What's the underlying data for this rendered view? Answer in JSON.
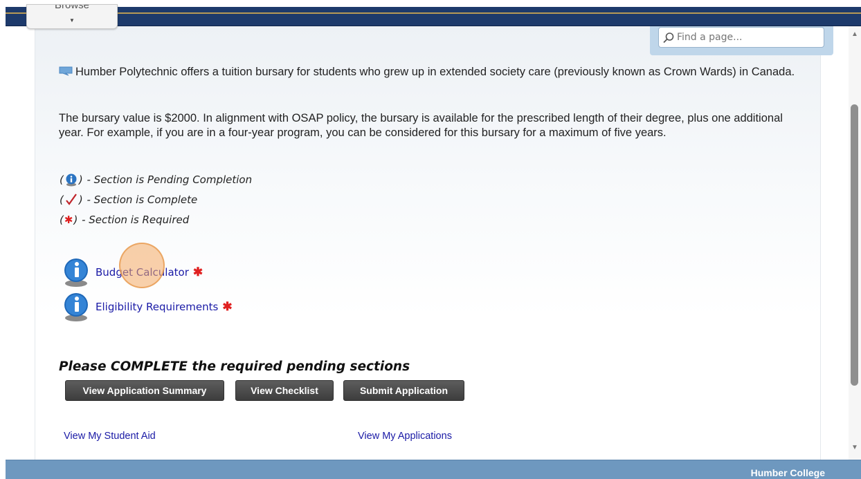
{
  "header": {
    "browse_label": "Browse"
  },
  "search": {
    "placeholder": "Find a page..."
  },
  "content": {
    "intro": "Humber Polytechnic offers a tuition bursary for students who grew up in extended society care (previously known as Crown Wards) in Canada.",
    "details": "The bursary value is $2000. In alignment with OSAP policy, the bursary is available for the prescribed length of their degree, plus one additional year. For example, if you are in a four-year program, you can be considered for this bursary for a maximum of five years."
  },
  "legend": {
    "pending": "- Section is Pending Completion",
    "complete": "- Section is Complete",
    "required": "- Section is Required",
    "required_symbol": "✱"
  },
  "sections": [
    {
      "label": "Budget Calculator",
      "required_symbol": "✱",
      "icon": "info-icon"
    },
    {
      "label": "Eligibility Requirements",
      "required_symbol": "✱",
      "icon": "info-icon"
    }
  ],
  "status": {
    "heading": "Please COMPLETE the required pending sections"
  },
  "buttons": {
    "summary": "View Application Summary",
    "checklist": "View Checklist",
    "submit": "Submit Application"
  },
  "links": {
    "student_aid": "View My Student Aid",
    "applications": "View My Applications"
  },
  "footer": {
    "brand": "Humber College"
  },
  "colors": {
    "header_navy": "#1d3a6b",
    "footer_blue": "#6e98bf",
    "link_blue": "#1a1aa6",
    "required_red": "#e02020"
  }
}
